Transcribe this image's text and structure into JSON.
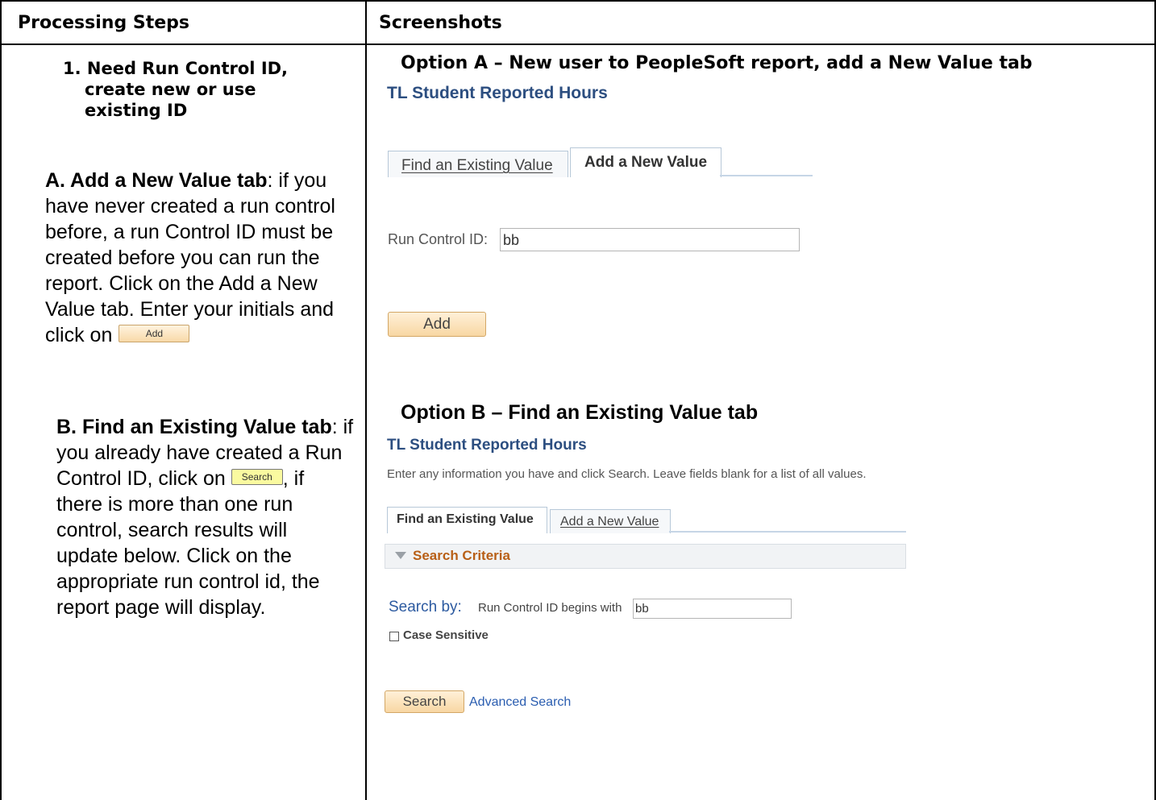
{
  "headers": {
    "left": "Processing Steps",
    "right": "Screenshots"
  },
  "steps": {
    "number": "1.",
    "title_line1": "Need Run Control ID,",
    "title_line2": "create new or use",
    "title_line3": "existing ID",
    "a_bold": "A. Add a New Value tab",
    "a_line1": ": if you",
    "a_line2": "have never created a run control",
    "a_line3": "before, a run Control ID must be",
    "a_line4": "created before you can run the",
    "a_line5": "report. Click on the Add a New",
    "a_line6": "Value tab. Enter your initials and",
    "a_line7": "click on",
    "a_button": "Add",
    "b_bold": "B. Find an Existing Value tab",
    "b_line1": ": if",
    "b_line2": "you already have created a Run",
    "b_line3a": "Control ID, click on",
    "b_button": "Search",
    "b_line3b": ", if",
    "b_line4": "there is more than one run",
    "b_line5": "control, search results will",
    "b_line6": "update below. Click on the",
    "b_line7": "appropriate run control id, the",
    "b_line8": "report page will display."
  },
  "option_a": {
    "heading": "Option A – New user to PeopleSoft report, add a New Value tab",
    "page_title": "TL Student Reported Hours",
    "tab_find": "Find an Existing Value",
    "tab_add": "Add a New Value",
    "field_label": "Run Control ID:",
    "field_value": "bb",
    "button": "Add"
  },
  "option_b": {
    "heading": "Option B – Find an Existing Value tab",
    "page_title": "TL Student Reported Hours",
    "instructions": "Enter any information you have and click Search. Leave fields blank for a list of all values.",
    "tab_find": "Find an Existing Value",
    "tab_add": "Add a New Value",
    "criteria": "Search Criteria",
    "search_by": "Search by:",
    "field_label": "Run Control ID begins with",
    "field_value": "bb",
    "case_sensitive": "Case Sensitive",
    "button": "Search",
    "advanced": "Advanced Search"
  }
}
